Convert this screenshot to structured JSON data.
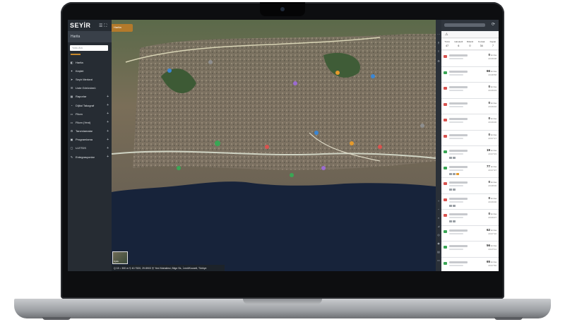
{
  "app": {
    "logo_text": "SEYİR",
    "logo_accent": "İ"
  },
  "colors": {
    "accent": "#c7892c",
    "sidebar": "#262c33",
    "sea": "#17233a"
  },
  "sidebar": {
    "header": "Harita",
    "search_placeholder": "Yolcu Ara",
    "items": [
      {
        "label": "Harita",
        "icon": "map-icon",
        "has_children": false
      },
      {
        "label": "Keşfet",
        "icon": "compass-icon",
        "has_children": false
      },
      {
        "label": "Seyir Merkezi",
        "icon": "navigation-icon",
        "has_children": false
      },
      {
        "label": "Liste Görünümü",
        "icon": "list-icon",
        "has_children": false
      },
      {
        "label": "Raporlar",
        "icon": "report-icon",
        "has_children": true
      },
      {
        "label": "Dijital Takograf",
        "icon": "tachograph-icon",
        "has_children": true
      },
      {
        "label": "Filom",
        "icon": "truck-icon",
        "has_children": true
      },
      {
        "label": "Filom (Yeni)",
        "icon": "truck-icon",
        "has_children": true
      },
      {
        "label": "Tanımlamalar",
        "icon": "settings-icon",
        "has_children": true
      },
      {
        "label": "Programlama",
        "icon": "calendar-icon",
        "has_children": true
      },
      {
        "label": "U-ETDS",
        "icon": "bus-icon",
        "has_children": true
      },
      {
        "label": "Entegrasyonlar",
        "icon": "plug-icon",
        "has_children": true
      }
    ]
  },
  "map": {
    "tab_label": "Harita",
    "thumbnail_label": "Uydu",
    "status_text": "Q 15  ↕ 300 m  ⚲ 40.7520, 29.8903  ⦿ Yeni Mahallesi, Bilge Sk., İzmit/Kocaeli, Türkiye"
  },
  "panel": {
    "stats": [
      {
        "label": "Tümü",
        "value": "47"
      },
      {
        "label": "Hareketli",
        "value": "6"
      },
      {
        "label": "Rölanti",
        "value": "0"
      },
      {
        "label": "Kontak",
        "value": "34"
      },
      {
        "label": "Kapalı",
        "value": "7"
      }
    ],
    "vehicles": [
      {
        "speed": "0",
        "unit": "km/sa",
        "time": "23:29:08",
        "color": "#d9534f",
        "badges": 0
      },
      {
        "speed": "66",
        "unit": "km/sa",
        "time": "23:28:58",
        "color": "#3aa655",
        "badges": 0
      },
      {
        "speed": "0",
        "unit": "km/sa",
        "time": "23:29:03",
        "color": "#d9534f",
        "badges": 0
      },
      {
        "speed": "0",
        "unit": "km/sa",
        "time": "23:29:02",
        "color": "#d9534f",
        "badges": 0
      },
      {
        "speed": "0",
        "unit": "km/sa",
        "time": "23:29:06",
        "color": "#d9534f",
        "badges": 0
      },
      {
        "speed": "0",
        "unit": "km/sa",
        "time": "23:27:17",
        "color": "#d9534f",
        "badges": 0
      },
      {
        "speed": "19",
        "unit": "km/sa",
        "time": "23:27:03",
        "color": "#3aa655",
        "badges": 2
      },
      {
        "speed": "77",
        "unit": "km/sa",
        "time": "23:27:37",
        "color": "#3aa655",
        "badges": 3
      },
      {
        "speed": "0",
        "unit": "km/sa",
        "time": "23:28:00",
        "color": "#d9534f",
        "badges": 2
      },
      {
        "speed": "0",
        "unit": "km/sa",
        "time": "23:29:00",
        "color": "#d9534f",
        "badges": 2
      },
      {
        "speed": "0",
        "unit": "km/sa",
        "time": "23:29:07",
        "color": "#d9534f",
        "badges": 2
      },
      {
        "speed": "62",
        "unit": "km/sa",
        "time": "23:27:10",
        "color": "#3aa655",
        "badges": 0
      },
      {
        "speed": "56",
        "unit": "km/sa",
        "time": "23:27:11",
        "color": "#3aa655",
        "badges": 0
      },
      {
        "speed": "65",
        "unit": "km/sa",
        "time": "23:27:50",
        "color": "#3aa655",
        "badges": 0
      }
    ]
  }
}
